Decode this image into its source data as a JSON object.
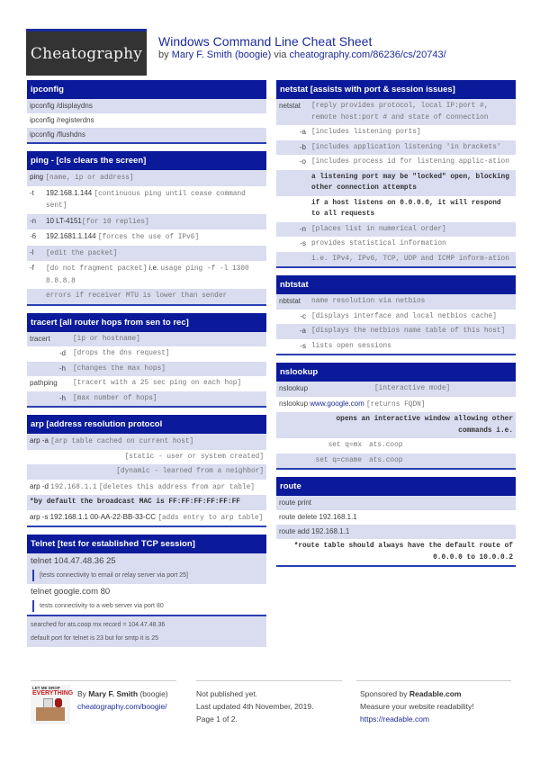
{
  "header": {
    "logo": "Cheatography",
    "title": "Windows Command Line Cheat Sheet",
    "by": "by ",
    "author": "Mary F. Smith (boogie)",
    "via": " via ",
    "url": "cheatography.com/86236/cs/20743/"
  },
  "ipconfig": {
    "title": "ipconfig",
    "rows": [
      "ipconfig /displaydns",
      "ipconfig /registerdns",
      "ipconfig /flushdns"
    ]
  },
  "ping": {
    "title": "ping - [cls clears the screen]",
    "rows": [
      {
        "cmd": "ping",
        "desc": "[name, ip or address]"
      },
      {
        "key": "-t",
        "arg": "192.168.1.144",
        "desc": "[continuous ping until cease command sent]"
      },
      {
        "key": "-n",
        "arg": "10 LT-4151",
        "desc": "[for 10 replies]"
      },
      {
        "key": "-6",
        "arg": "192.1681.1.144",
        "desc": "[forces the use of IPv6]"
      },
      {
        "key": "-l",
        "arg": "",
        "desc": "[edit the packet]"
      },
      {
        "key": "-f",
        "desc": "[do not fragment packet]",
        "ie": "i.e.",
        "desc2": "usage ping -f -l 1300 8.8.8.8"
      },
      {
        "key": "",
        "desc": "errors if receiver MTU is lower than sender"
      }
    ]
  },
  "tracert": {
    "title": "tracert [all router hops from sen to rec]",
    "rows": [
      {
        "key": "tracert",
        "desc": "[ip or hostname]"
      },
      {
        "key": "-d",
        "desc": "[drops the dns request]"
      },
      {
        "key": "-h",
        "desc": "[changes the max hops]"
      },
      {
        "key": "pathping",
        "desc": "[tracert with a 25 sec ping on each hop]"
      },
      {
        "key": "-h",
        "desc": "[max number of hops]"
      }
    ]
  },
  "arp": {
    "title": "arp [address resolution protocol",
    "rows": [
      {
        "cmd": "arp -a",
        "desc": "[arp table cached on current host]"
      },
      {
        "desc": "[static - user or system created]"
      },
      {
        "desc": "[dynamic - learned from a neighbor]"
      },
      {
        "cmd": "arp -d",
        "arg": "192.168.1.1",
        "desc": "[deletes this address from apr table]"
      },
      {
        "bold": "*by default the broadcast MAC is FF:FF:FF:FF:FF:FF"
      },
      {
        "cmd": "arp -s 192.168.1.1 00-AA-22-BB-33-CC",
        "desc": "[adds entry to arp table]"
      }
    ]
  },
  "telnet": {
    "title": "Telnet [test for established TCP session]",
    "items": [
      {
        "cmd": "telnet 104.47.48.36 25",
        "note": "[tests connectivity to email or relay server via port 25]"
      },
      {
        "cmd": "telnet google.com 80",
        "note": "tests connectivity to a web server via port 80"
      }
    ],
    "footer": [
      "searched for ats.coop mx record = 104.47.48.36",
      "default port for telnet is 23 but for smtp it is 25"
    ]
  },
  "netstat": {
    "title": "netstat [assists with port & session issues]",
    "rows": [
      {
        "key": "netstat",
        "desc": "[reply provides protocol, local IP:port #, remote host:port # and state of connection"
      },
      {
        "key": "-a",
        "desc": "[includes listening ports]"
      },
      {
        "key": "-b",
        "desc": "[includes application listening 'in brackets'"
      },
      {
        "key": "-o",
        "desc": "[includes process id for listening applic-ation"
      },
      {
        "key": "",
        "bold": "a listening port may be \"locked\" open, blocking other connection attempts"
      },
      {
        "key": "",
        "bold": "if a host listens on 0.0.0.0, it will respond to all requests"
      },
      {
        "key": "-n",
        "desc": "[places list in numerical order]"
      },
      {
        "key": "-s",
        "desc": "provides statistical information"
      },
      {
        "key": "",
        "desc": "i.e. IPv4, IPv6, TCP, UDP and ICMP inform-ation"
      }
    ]
  },
  "nbtstat": {
    "title": "nbtstat",
    "rows": [
      {
        "key": "nbtstat",
        "desc": "name resolution via netbios"
      },
      {
        "key": "-c",
        "desc": "[displays interface and local netbios cache]"
      },
      {
        "key": "-a",
        "desc": "[displays the netbios name table of this host]"
      },
      {
        "key": "-s",
        "desc": "lists open sessions"
      }
    ]
  },
  "nslookup": {
    "title": "nslookup",
    "rows": [
      {
        "key": "nslookup",
        "desc": "[interactive mode]"
      },
      {
        "key": "nslookup",
        "link": "www.google.com",
        "desc": "[returns FQDN]"
      },
      {
        "bold": "opens an interactive window allowing other commands i.e."
      },
      {
        "key": "set q=mx",
        "desc": "ats.coop"
      },
      {
        "key": "set q=cname",
        "desc": "ats.coop"
      }
    ]
  },
  "route": {
    "title": "route",
    "rows": [
      "route print",
      "route delete 192.168.1.1",
      "route add 192.168.1.1"
    ],
    "note": "*route table should always have the default route of 0.0.0.0 to 10.0.0.2"
  },
  "footer": {
    "avatar_text1": "LET ME DROP",
    "avatar_text2": "EVERYTHING",
    "by": "By ",
    "author": "Mary F. Smith",
    "handle": " (boogie)",
    "author_url": "cheatography.com/boogie/",
    "status": "Not published yet.",
    "updated": "Last updated 4th November, 2019.",
    "page": "Page 1 of 2.",
    "sponsor_pre": "Sponsored by ",
    "sponsor": "Readable.com",
    "sponsor_tagline": "Measure your website readability!",
    "sponsor_url": "https://readable.com"
  }
}
